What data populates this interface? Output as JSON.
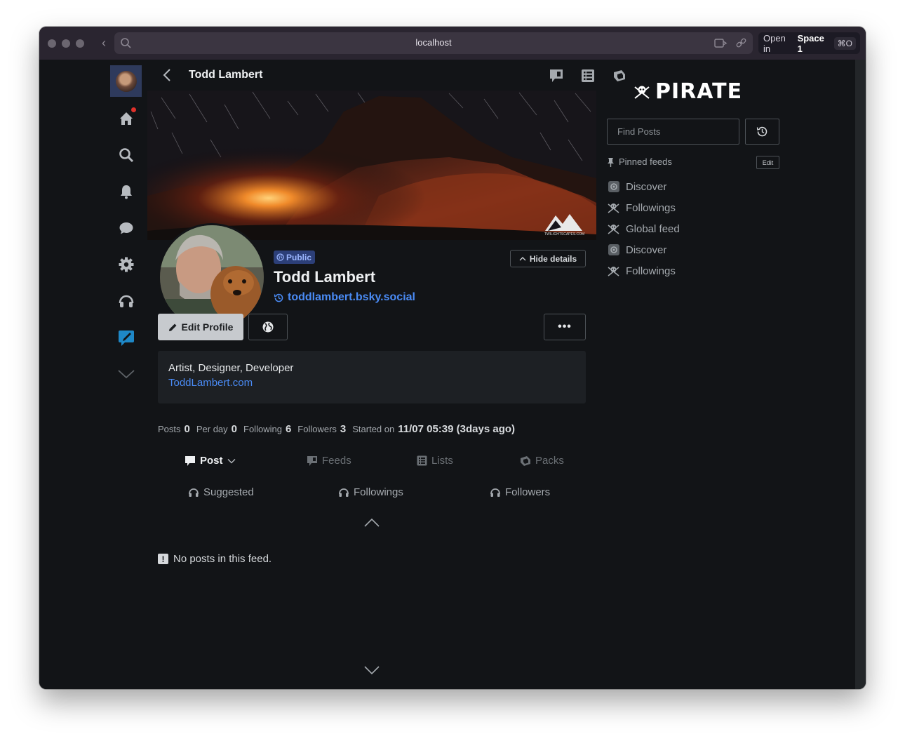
{
  "browser": {
    "url": "localhost",
    "space_prefix": "Open in",
    "space_name": "Space 1",
    "shortcut": "⌘O"
  },
  "header": {
    "title": "Todd Lambert"
  },
  "profile": {
    "visibility": "Public",
    "hide_details": "Hide details",
    "display_name": "Todd Lambert",
    "handle": "toddlambert.bsky.social",
    "edit_profile": "Edit Profile",
    "more": "•••",
    "bio": "Artist, Designer, Developer",
    "link": "ToddLambert.com",
    "banner_watermark": "TWILIGHTSCAPES.COM"
  },
  "stats": {
    "posts_label": "Posts",
    "posts": "0",
    "per_day_label": "Per day",
    "per_day": "0",
    "following_label": "Following",
    "following": "6",
    "followers_label": "Followers",
    "followers": "3",
    "started_label": "Started on",
    "started": "11/07 05:39 (3days ago)"
  },
  "tabs": {
    "post": "Post",
    "feeds": "Feeds",
    "lists": "Lists",
    "packs": "Packs",
    "suggested": "Suggested",
    "followings": "Followings",
    "followers": "Followers"
  },
  "empty_state": "No posts in this feed.",
  "sidebar_right": {
    "logo": "PIRATE",
    "search_placeholder": "Find Posts",
    "pinned_label": "Pinned feeds",
    "edit": "Edit",
    "feeds": [
      {
        "label": "Discover",
        "icon": "discover-icon"
      },
      {
        "label": "Followings",
        "icon": "pirate-icon"
      },
      {
        "label": "Global feed",
        "icon": "pirate-icon"
      },
      {
        "label": "Discover",
        "icon": "discover-icon"
      },
      {
        "label": "Followings",
        "icon": "pirate-icon"
      }
    ]
  },
  "colors": {
    "accent": "#4a8bf5",
    "notification_dot": "#e0312b",
    "active_compose": "#1e88c7"
  }
}
